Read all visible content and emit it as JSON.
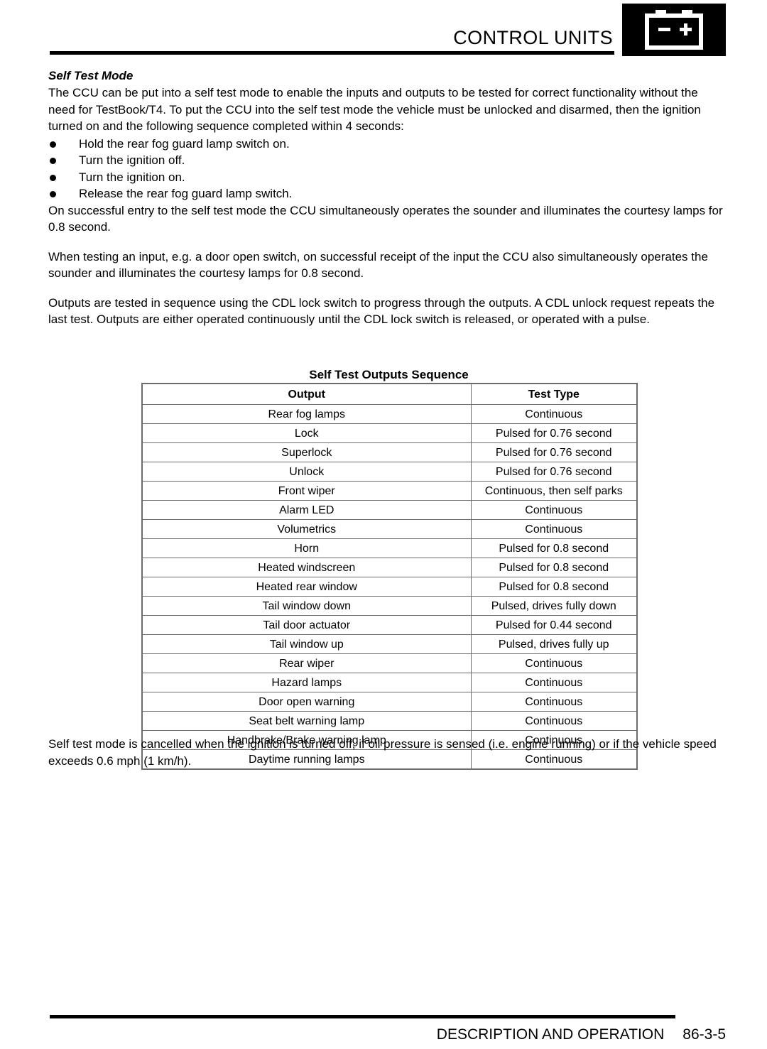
{
  "header": {
    "title": "CONTROL UNITS",
    "icon": "battery-icon",
    "icon_minus": "−",
    "icon_plus": "+"
  },
  "content": {
    "section_heading": "Self Test Mode",
    "intro_paragraph": "The CCU can be put into a self test mode to enable the inputs and outputs to be tested for correct functionality without the need for TestBook/T4. To put the CCU into the self test mode the vehicle must be unlocked and disarmed, then the ignition turned on and the following sequence completed within 4 seconds:",
    "bullets": [
      "Hold the rear fog guard lamp switch on.",
      "Turn the ignition off.",
      "Turn the ignition on.",
      "Release the rear fog guard lamp switch."
    ],
    "paragraphs": [
      "On successful entry to the self test mode the CCU simultaneously operates the sounder and illuminates the courtesy lamps for 0.8 second.",
      "When testing an input, e.g. a door open switch, on successful receipt of the input the CCU also simultaneously operates the sounder and illuminates the courtesy lamps for 0.8 second.",
      "Outputs are tested in sequence using the CDL lock switch to progress through the outputs. A CDL unlock request repeats the last test. Outputs are either operated continuously until the CDL lock switch is released, or operated with a pulse."
    ],
    "closing_paragraph": "Self test mode is cancelled when the ignition is turned off, if oil pressure is sensed (i.e. engine running) or if the vehicle speed exceeds 0.6 mph (1 km/h)."
  },
  "table": {
    "title": "Self Test Outputs Sequence",
    "columns": [
      "Output",
      "Test Type"
    ],
    "rows": [
      [
        "Rear fog lamps",
        "Continuous"
      ],
      [
        "Lock",
        "Pulsed for 0.76 second"
      ],
      [
        "Superlock",
        "Pulsed for 0.76 second"
      ],
      [
        "Unlock",
        "Pulsed for 0.76 second"
      ],
      [
        "Front wiper",
        "Continuous, then self parks"
      ],
      [
        "Alarm LED",
        "Continuous"
      ],
      [
        "Volumetrics",
        "Continuous"
      ],
      [
        "Horn",
        "Pulsed for 0.8 second"
      ],
      [
        "Heated windscreen",
        "Pulsed for 0.8 second"
      ],
      [
        "Heated rear window",
        "Pulsed for 0.8 second"
      ],
      [
        "Tail window down",
        "Pulsed, drives fully down"
      ],
      [
        "Tail door actuator",
        "Pulsed for 0.44 second"
      ],
      [
        "Tail window up",
        "Pulsed, drives fully up"
      ],
      [
        "Rear wiper",
        "Continuous"
      ],
      [
        "Hazard lamps",
        "Continuous"
      ],
      [
        "Door open warning",
        "Continuous"
      ],
      [
        "Seat belt warning lamp",
        "Continuous"
      ],
      [
        "Handbrake/Brake warning lamp",
        "Continuous"
      ],
      [
        "Daytime running lamps",
        "Continuous"
      ]
    ]
  },
  "footer": {
    "section_label": "DESCRIPTION AND OPERATION",
    "page_number": "86-3-5"
  }
}
